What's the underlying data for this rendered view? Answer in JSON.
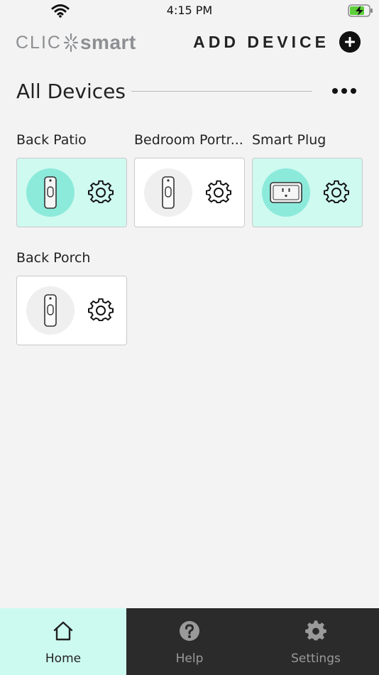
{
  "status_bar": {
    "time": "4:15 PM"
  },
  "header": {
    "logo_left": "CLIC",
    "logo_right": "smart",
    "add_device_label": "ADD DEVICE"
  },
  "section": {
    "title": "All Devices"
  },
  "devices": [
    {
      "name": "Back Patio",
      "icon": "doorbell-icon",
      "active": true
    },
    {
      "name": "Bedroom Portr...",
      "icon": "doorbell-icon",
      "active": false
    },
    {
      "name": "Smart Plug",
      "icon": "smart-plug-icon",
      "active": true
    },
    {
      "name": "Back Porch",
      "icon": "doorbell-icon",
      "active": false
    }
  ],
  "tabs": [
    {
      "label": "Home",
      "icon": "home-icon",
      "selected": true
    },
    {
      "label": "Help",
      "icon": "help-icon",
      "selected": false
    },
    {
      "label": "Settings",
      "icon": "settings-icon",
      "selected": false
    }
  ],
  "colors": {
    "active_card": "#cffaf0",
    "active_thumb": "#8ceadb",
    "tab_bar": "#2b2b2b",
    "tab_selected": "#cdfaf0"
  }
}
